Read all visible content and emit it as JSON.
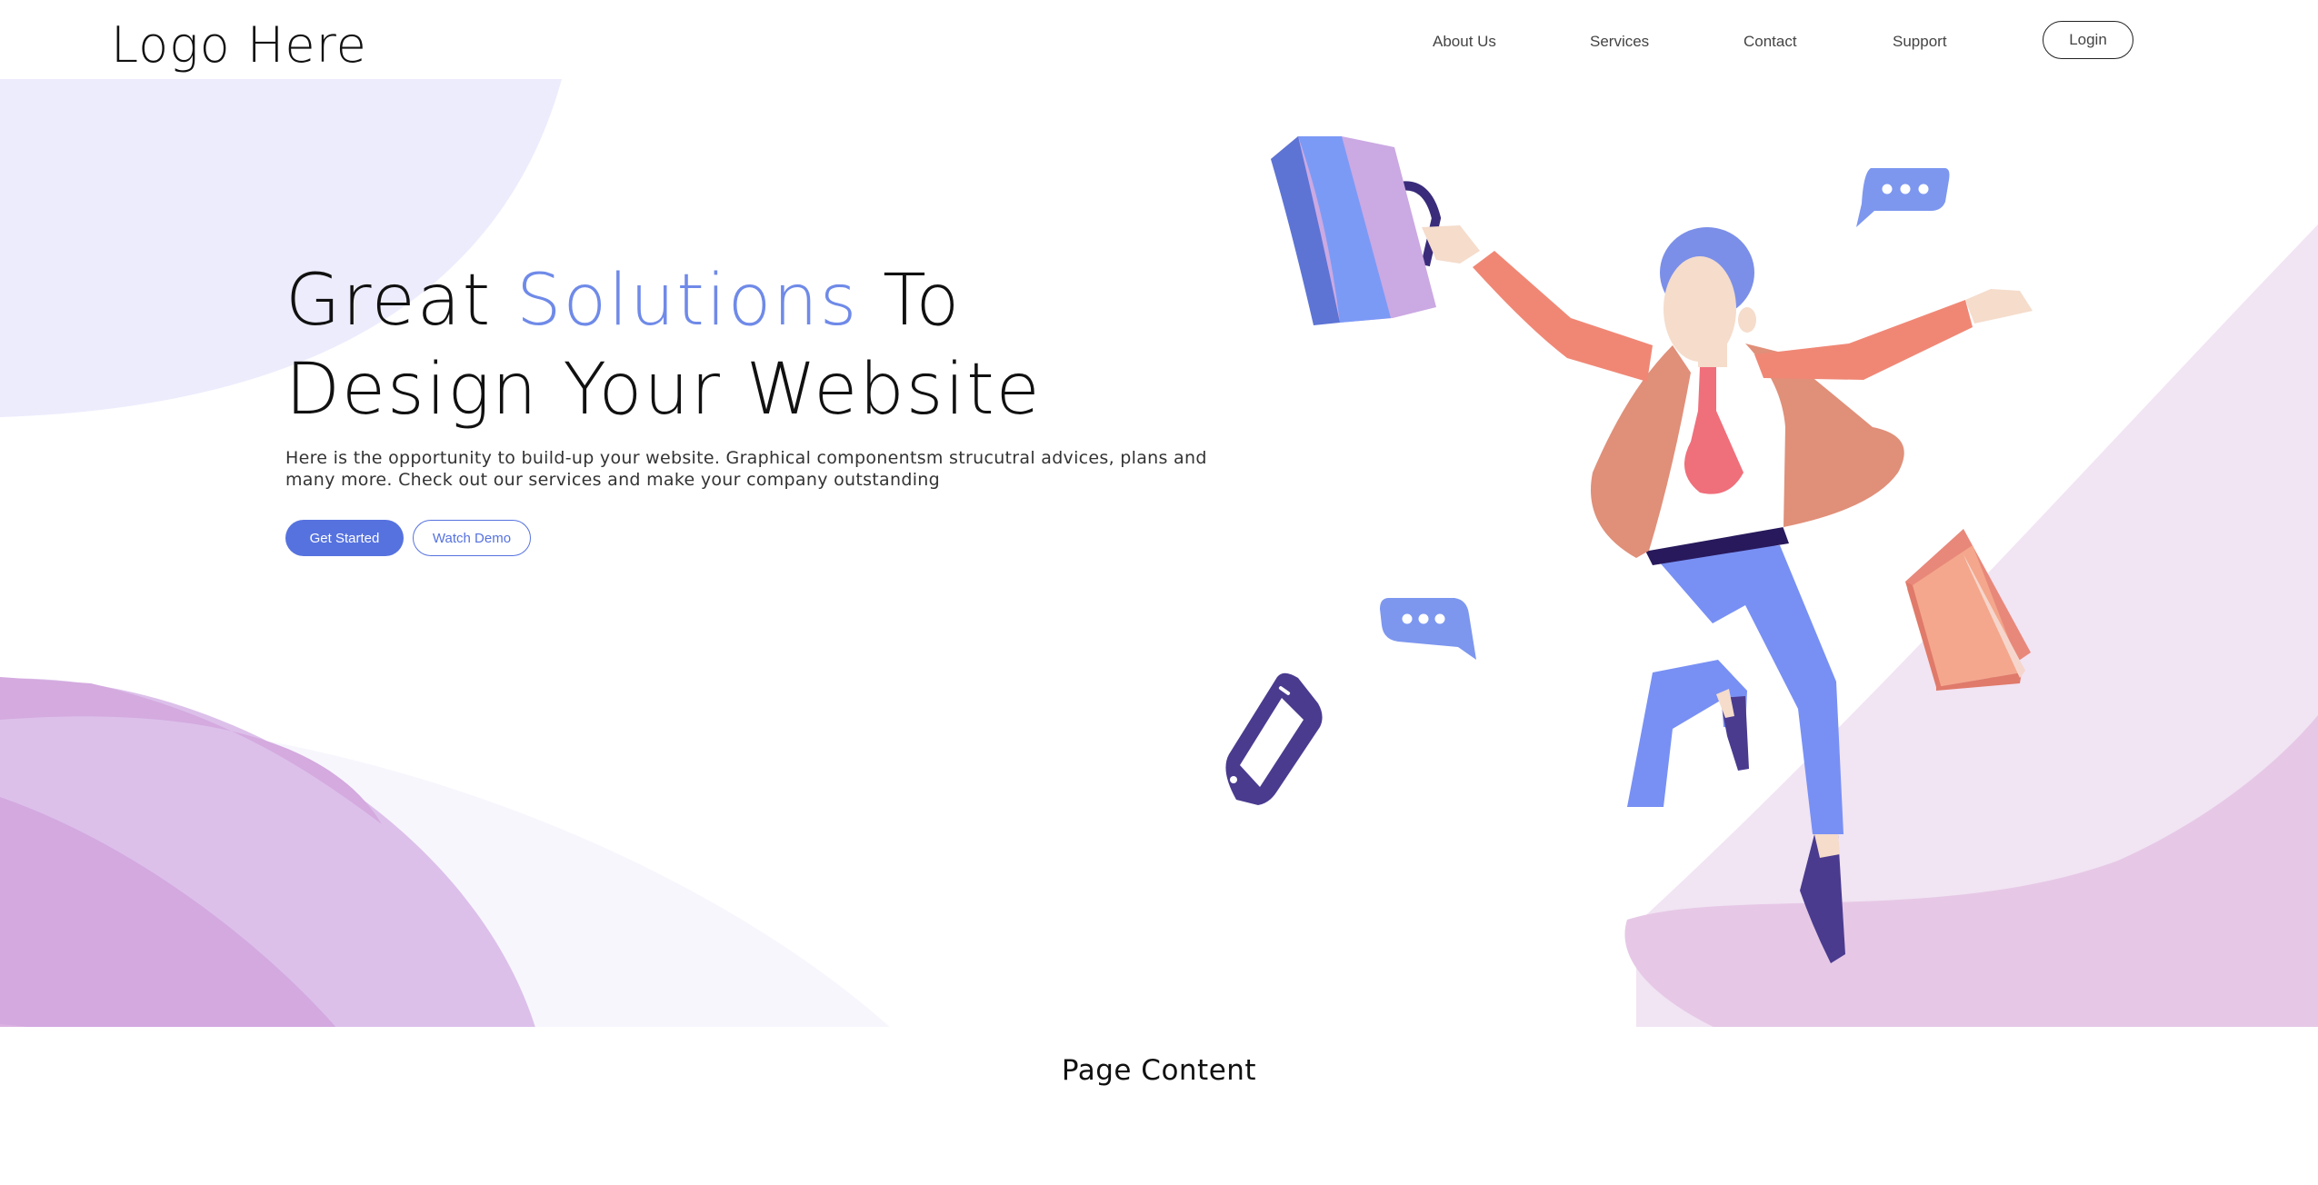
{
  "header": {
    "logo": "Logo Here",
    "nav": [
      {
        "label": "About Us"
      },
      {
        "label": "Services"
      },
      {
        "label": "Contact"
      },
      {
        "label": "Support"
      }
    ],
    "login_label": "Login"
  },
  "hero": {
    "headline_part1": "Great ",
    "headline_accent": "Solutions",
    "headline_part2": " To",
    "headline_line2": "Design Your Website",
    "subtext": "Here is the opportunity to build-up your website. Graphical componentsm strucutral advices, plans and many more. Check out our services and make your company outstanding",
    "primary_button": "Get Started",
    "secondary_button": "Watch Demo"
  },
  "main": {
    "page_content": "Page Content"
  },
  "colors": {
    "accent": "#6f8ae8",
    "button_primary": "#5672df",
    "blob_light": "#ececfd",
    "blob_purple": "#d3a9e0",
    "blob_pink": "#efe2f1"
  }
}
